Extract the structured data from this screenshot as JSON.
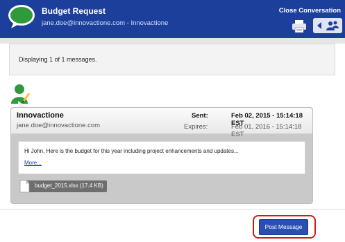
{
  "header": {
    "title": "Budget Request",
    "subtitle": "jane.doe@innovactione.com - Innovactione",
    "close_label": "Close Conversation",
    "icons": [
      "chat-bubble-icon",
      "printer-icon",
      "arrow-left-icon",
      "people-icon"
    ],
    "color": "#1d3f9c"
  },
  "status": {
    "text": "Displaying 1 of 1 messages."
  },
  "message": {
    "sender_name": "Innovactione",
    "sender_email": "jane.doe@innovactione.com",
    "sent_label": "Sent:",
    "sent_value": "Feb 02, 2015 - 15:14:18 EST",
    "expires_label": "Expires:",
    "expires_value": "Feb 01, 2016 - 15:14:18 EST",
    "body": "Hi John,  Here is the budget for this year including project enhancements and updates...",
    "more_label": "More...",
    "attachment": "budget_2015.xlsx (17.4 KB)"
  },
  "footer": {
    "post_label": "Post Message",
    "highlight_color": "#d41818"
  }
}
